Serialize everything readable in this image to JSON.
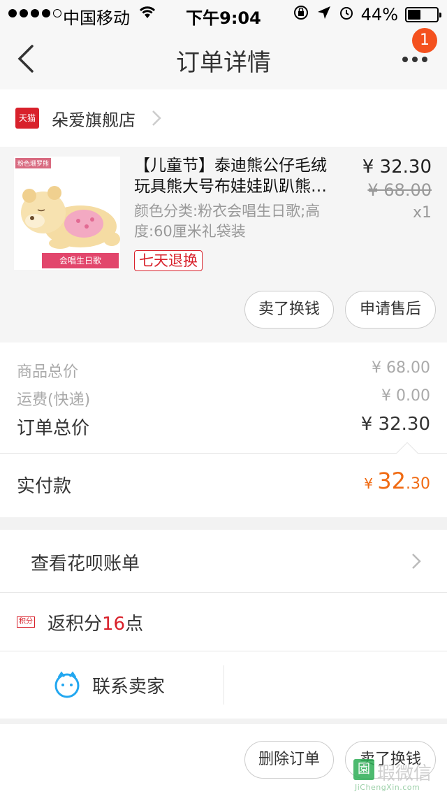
{
  "status_bar": {
    "carrier": "中国移动",
    "time": "下午9:04",
    "battery": "44%",
    "battery_level": 0.44
  },
  "nav": {
    "title": "订单详情",
    "badge_count": "1"
  },
  "shop": {
    "badge": "天猫",
    "name": "朵爱旗舰店"
  },
  "product": {
    "image_tag": "粉色珊罗熊",
    "image_label": "会唱生日歌",
    "title_line1": "【儿童节】泰迪熊公仔毛绒",
    "title_line2": "玩具熊大号布娃娃趴趴熊…",
    "sku": "颜色分类:粉衣会唱生日歌;高度:60厘米礼袋装",
    "price": "¥ 32.30",
    "original_price": "¥ 68.00",
    "quantity": "x1",
    "return_tag": "七天退换",
    "btn_sell": "卖了换钱",
    "btn_aftersale": "申请售后"
  },
  "summary": {
    "goods_total_label": "商品总价",
    "goods_total": "¥ 68.00",
    "shipping_label": "运费(快递)",
    "shipping": "¥ 0.00",
    "order_total_label": "订单总价",
    "order_total": "¥ 32.30"
  },
  "paid": {
    "label": "实付款",
    "currency": "¥ ",
    "integer": "32",
    "decimal": ".30"
  },
  "huabei": {
    "label": "查看花呗账单"
  },
  "points": {
    "tag": "积分",
    "prefix": "返积分",
    "number": "16",
    "suffix": "点"
  },
  "contact": {
    "label": "联系卖家"
  },
  "footer": {
    "btn_delete": "删除订单",
    "btn_sell": "卖了换钱"
  },
  "watermark": {
    "mark": "園",
    "cn": "瑕微信",
    "en": "JiChengXin.com"
  }
}
